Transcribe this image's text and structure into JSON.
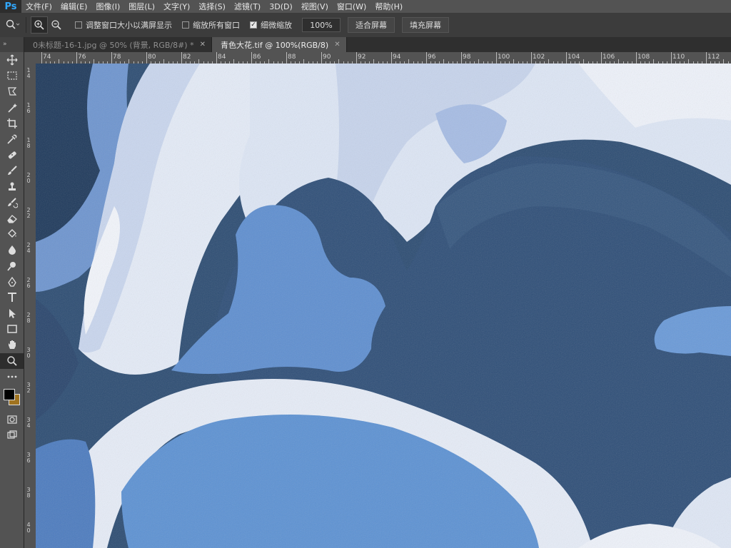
{
  "app": {
    "logo": "Ps"
  },
  "menu": [
    "文件(F)",
    "编辑(E)",
    "图像(I)",
    "图层(L)",
    "文字(Y)",
    "选择(S)",
    "滤镜(T)",
    "3D(D)",
    "视图(V)",
    "窗口(W)",
    "帮助(H)"
  ],
  "options": {
    "fit_window_label": "调整窗口大小以满屏显示",
    "fit_window_checked": false,
    "zoom_all_label": "缩放所有窗口",
    "zoom_all_checked": false,
    "scrubby_label": "细微缩放",
    "scrubby_checked": true,
    "zoom_value": "100%",
    "fit_screen": "适合屏幕",
    "fill_screen": "填充屏幕"
  },
  "tabs": [
    {
      "label": "0未标题-16-1.jpg @ 50% (背景, RGB/8#) *",
      "active": false
    },
    {
      "label": "青色大花.tif @ 100%(RGB/8)",
      "active": true
    }
  ],
  "ruler_top": [
    "74",
    "76",
    "78",
    "80",
    "82",
    "84",
    "86",
    "88",
    "90",
    "92",
    "94",
    "96",
    "98",
    "100",
    "102",
    "104",
    "106",
    "108",
    "110",
    "112"
  ],
  "ruler_left": [
    "14",
    "16",
    "18",
    "20",
    "22",
    "24",
    "26",
    "28",
    "30",
    "32",
    "34",
    "36",
    "38",
    "40"
  ],
  "colors": {
    "foreground": "#000000",
    "background": "#a0731f",
    "accent": "#31a8ff"
  },
  "toolbar": {
    "grip": "»",
    "tools": [
      "move-icon",
      "marquee-icon",
      "lasso-icon",
      "magic-wand-icon",
      "crop-icon",
      "eyedropper-icon",
      "healing-brush-icon",
      "brush-icon",
      "clone-stamp-icon",
      "history-brush-icon",
      "eraser-icon",
      "paint-bucket-icon",
      "blur-icon",
      "dodge-icon",
      "pen-icon",
      "type-icon",
      "path-selection-icon",
      "rectangle-icon",
      "hand-icon",
      "zoom-icon",
      "more-tools-icon"
    ]
  }
}
